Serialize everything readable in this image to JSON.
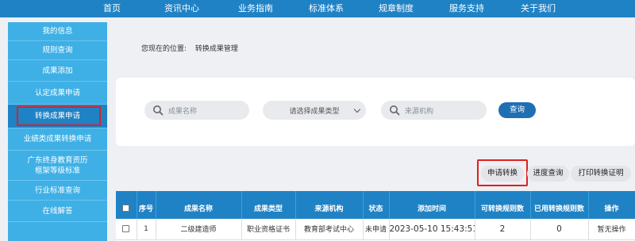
{
  "topnav": {
    "items": [
      "首页",
      "资讯中心",
      "业务指南",
      "标准体系",
      "规章制度",
      "服务支持",
      "关于我们"
    ]
  },
  "sidebar": {
    "items": [
      "我的信息",
      "规则查询",
      "成果添加",
      "认定成果申请",
      "转换成果申请",
      "业绩类成果转换申请",
      "广东终身教育资历",
      "框架等级标准",
      "行业标准查询",
      "在线解答"
    ],
    "active_index": 4
  },
  "breadcrumb": {
    "prefix": "您现在的位置:",
    "current": "转换成果管理"
  },
  "search": {
    "name_placeholder": "成果名称",
    "type_select": "请选择成果类型",
    "source_placeholder": "来源机构",
    "query_label": "查询"
  },
  "actions": {
    "apply_label": "申请转换",
    "progress_label": "进度查询",
    "print_label": "打印转换证明"
  },
  "table": {
    "headers": [
      "",
      "序号",
      "成果名称",
      "成果类型",
      "来源机构",
      "状态",
      "添加时间",
      "可转换规则数",
      "已用转换规则数",
      "操作"
    ],
    "rows": [
      [
        "",
        "1",
        "二级建造师",
        "职业资格证书",
        "教育部考试中心",
        "未申请",
        "2023-05-10 15:43:51",
        "2",
        "0",
        "暂无操作"
      ]
    ]
  },
  "colors": {
    "nav_bg": "#1f82c5",
    "sidebar_bg": "#3fb0e6",
    "highlight": "#e02020",
    "query_btn": "#1f6fb3"
  }
}
